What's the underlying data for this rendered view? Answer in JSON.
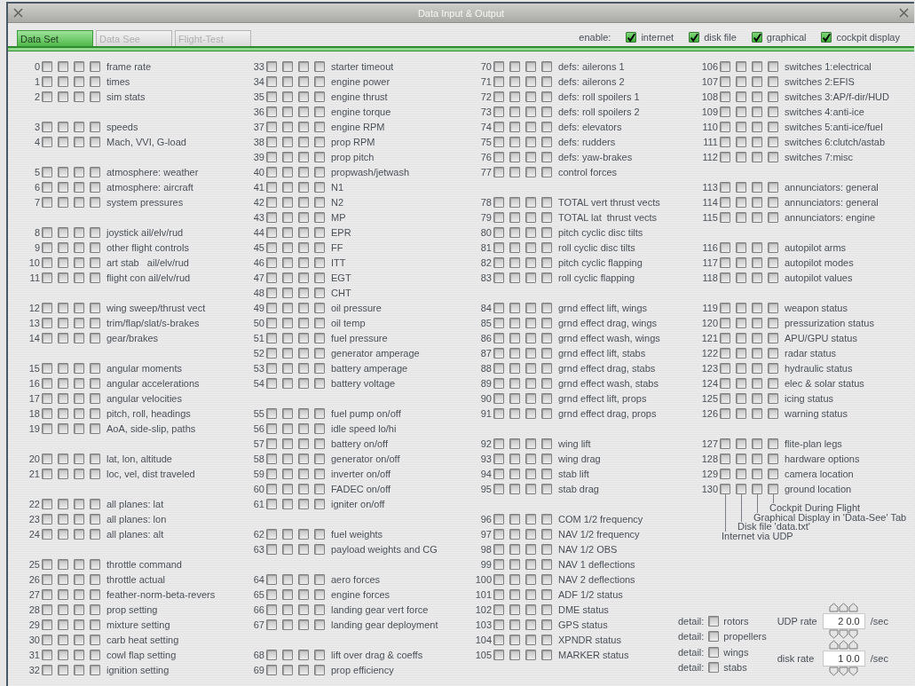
{
  "window": {
    "title": "Data Input & Output"
  },
  "tabs": [
    {
      "label": "Data Set",
      "selected": true
    },
    {
      "label": "Data See",
      "selected": false
    },
    {
      "label": "Flight-Test",
      "selected": false
    }
  ],
  "enable": {
    "label": "enable:",
    "options": [
      {
        "label": "internet",
        "checked": true
      },
      {
        "label": "disk file",
        "checked": true
      },
      {
        "label": "graphical",
        "checked": true
      },
      {
        "label": "cockpit display",
        "checked": true
      }
    ]
  },
  "columns": [
    {
      "groups": [
        {
          "rows": [
            {
              "index": "0",
              "label": "frame rate",
              "checked": [
                false,
                false,
                false,
                false
              ]
            },
            {
              "index": "1",
              "label": "times",
              "checked": [
                false,
                false,
                false,
                false
              ]
            },
            {
              "index": "2",
              "label": "sim stats",
              "checked": [
                false,
                false,
                false,
                false
              ]
            }
          ]
        },
        {
          "rows": [
            {
              "index": "3",
              "label": "speeds",
              "checked": [
                false,
                false,
                false,
                false
              ]
            },
            {
              "index": "4",
              "label": "Mach, VVI, G-load",
              "checked": [
                false,
                false,
                false,
                false
              ]
            }
          ]
        },
        {
          "rows": [
            {
              "index": "5",
              "label": "atmosphere: weather",
              "checked": [
                false,
                false,
                false,
                false
              ]
            },
            {
              "index": "6",
              "label": "atmosphere: aircraft",
              "checked": [
                false,
                false,
                false,
                false
              ]
            },
            {
              "index": "7",
              "label": "system pressures",
              "checked": [
                false,
                false,
                false,
                false
              ]
            }
          ]
        },
        {
          "rows": [
            {
              "index": "8",
              "label": "joystick ail/elv/rud",
              "checked": [
                false,
                false,
                false,
                false
              ]
            },
            {
              "index": "9",
              "label": "other flight controls",
              "checked": [
                false,
                false,
                false,
                false
              ]
            },
            {
              "index": "10",
              "label": "art stab   ail/elv/rud",
              "checked": [
                false,
                false,
                false,
                false
              ]
            },
            {
              "index": "11",
              "label": "flight con ail/elv/rud",
              "checked": [
                false,
                false,
                false,
                false
              ]
            }
          ]
        },
        {
          "rows": [
            {
              "index": "12",
              "label": "wing sweep/thrust vect",
              "checked": [
                false,
                false,
                false,
                false
              ]
            },
            {
              "index": "13",
              "label": "trim/flap/slat/s-brakes",
              "checked": [
                false,
                false,
                false,
                false
              ]
            },
            {
              "index": "14",
              "label": "gear/brakes",
              "checked": [
                false,
                false,
                false,
                false
              ]
            }
          ]
        },
        {
          "rows": [
            {
              "index": "15",
              "label": "angular moments",
              "checked": [
                false,
                false,
                false,
                false
              ]
            },
            {
              "index": "16",
              "label": "angular accelerations",
              "checked": [
                false,
                false,
                false,
                false
              ]
            },
            {
              "index": "17",
              "label": "angular velocities",
              "checked": [
                false,
                false,
                false,
                false
              ]
            },
            {
              "index": "18",
              "label": "pitch, roll, headings",
              "checked": [
                false,
                false,
                false,
                false
              ]
            },
            {
              "index": "19",
              "label": "AoA, side-slip, paths",
              "checked": [
                false,
                false,
                false,
                false
              ]
            }
          ]
        },
        {
          "rows": [
            {
              "index": "20",
              "label": "lat, lon, altitude",
              "checked": [
                false,
                false,
                false,
                false
              ]
            },
            {
              "index": "21",
              "label": "loc, vel, dist traveled",
              "checked": [
                false,
                false,
                false,
                false
              ]
            }
          ]
        },
        {
          "rows": [
            {
              "index": "22",
              "label": "all planes: lat",
              "checked": [
                false,
                false,
                false,
                false
              ]
            },
            {
              "index": "23",
              "label": "all planes: lon",
              "checked": [
                false,
                false,
                false,
                false
              ]
            },
            {
              "index": "24",
              "label": "all planes: alt",
              "checked": [
                false,
                false,
                false,
                false
              ]
            }
          ]
        },
        {
          "rows": [
            {
              "index": "25",
              "label": "throttle command",
              "checked": [
                false,
                false,
                false,
                false
              ]
            },
            {
              "index": "26",
              "label": "throttle actual",
              "checked": [
                false,
                false,
                false,
                false
              ]
            },
            {
              "index": "27",
              "label": "feather-norm-beta-revers",
              "checked": [
                false,
                false,
                false,
                false
              ]
            },
            {
              "index": "28",
              "label": "prop setting",
              "checked": [
                false,
                false,
                false,
                false
              ]
            },
            {
              "index": "29",
              "label": "mixture setting",
              "checked": [
                false,
                false,
                false,
                false
              ]
            },
            {
              "index": "30",
              "label": "carb heat setting",
              "checked": [
                false,
                false,
                false,
                false
              ]
            },
            {
              "index": "31",
              "label": "cowl flap setting",
              "checked": [
                false,
                false,
                false,
                false
              ]
            },
            {
              "index": "32",
              "label": "ignition setting",
              "checked": [
                false,
                false,
                false,
                false
              ]
            }
          ]
        }
      ]
    },
    {
      "groups": [
        {
          "rows": [
            {
              "index": "33",
              "label": "starter timeout",
              "checked": [
                false,
                false,
                false,
                false
              ]
            },
            {
              "index": "34",
              "label": "engine power",
              "checked": [
                false,
                false,
                false,
                false
              ]
            },
            {
              "index": "35",
              "label": "engine thrust",
              "checked": [
                false,
                false,
                false,
                false
              ]
            },
            {
              "index": "36",
              "label": "engine torque",
              "checked": [
                false,
                false,
                false,
                false
              ]
            },
            {
              "index": "37",
              "label": "engine RPM",
              "checked": [
                false,
                false,
                false,
                false
              ]
            },
            {
              "index": "38",
              "label": "prop RPM",
              "checked": [
                false,
                false,
                false,
                false
              ]
            },
            {
              "index": "39",
              "label": "prop pitch",
              "checked": [
                false,
                false,
                false,
                false
              ]
            },
            {
              "index": "40",
              "label": "propwash/jetwash",
              "checked": [
                false,
                false,
                false,
                false
              ]
            },
            {
              "index": "41",
              "label": "N1",
              "checked": [
                false,
                false,
                false,
                false
              ]
            },
            {
              "index": "42",
              "label": "N2",
              "checked": [
                false,
                false,
                false,
                false
              ]
            },
            {
              "index": "43",
              "label": "MP",
              "checked": [
                false,
                false,
                false,
                false
              ]
            },
            {
              "index": "44",
              "label": "EPR",
              "checked": [
                false,
                false,
                false,
                false
              ]
            },
            {
              "index": "45",
              "label": "FF",
              "checked": [
                false,
                false,
                false,
                false
              ]
            },
            {
              "index": "46",
              "label": "ITT",
              "checked": [
                false,
                false,
                false,
                false
              ]
            },
            {
              "index": "47",
              "label": "EGT",
              "checked": [
                false,
                false,
                false,
                false
              ]
            },
            {
              "index": "48",
              "label": "CHT",
              "checked": [
                false,
                false,
                false,
                false
              ]
            },
            {
              "index": "49",
              "label": "oil pressure",
              "checked": [
                false,
                false,
                false,
                false
              ]
            },
            {
              "index": "50",
              "label": "oil temp",
              "checked": [
                false,
                false,
                false,
                false
              ]
            },
            {
              "index": "51",
              "label": "fuel pressure",
              "checked": [
                false,
                false,
                false,
                false
              ]
            },
            {
              "index": "52",
              "label": "generator amperage",
              "checked": [
                false,
                false,
                false,
                false
              ]
            },
            {
              "index": "53",
              "label": "battery amperage",
              "checked": [
                false,
                false,
                false,
                false
              ]
            },
            {
              "index": "54",
              "label": "battery voltage",
              "checked": [
                false,
                false,
                false,
                false
              ]
            }
          ]
        },
        {
          "rows": [
            {
              "index": "55",
              "label": "fuel pump on/off",
              "checked": [
                false,
                false,
                false,
                false
              ]
            },
            {
              "index": "56",
              "label": "idle speed lo/hi",
              "checked": [
                false,
                false,
                false,
                false
              ]
            },
            {
              "index": "57",
              "label": "battery on/off",
              "checked": [
                false,
                false,
                false,
                false
              ]
            },
            {
              "index": "58",
              "label": "generator on/off",
              "checked": [
                false,
                false,
                false,
                false
              ]
            },
            {
              "index": "59",
              "label": "inverter on/off",
              "checked": [
                false,
                false,
                false,
                false
              ]
            },
            {
              "index": "60",
              "label": "FADEC on/off",
              "checked": [
                false,
                false,
                false,
                false
              ]
            },
            {
              "index": "61",
              "label": "igniter on/off",
              "checked": [
                false,
                false,
                false,
                false
              ]
            }
          ]
        },
        {
          "rows": [
            {
              "index": "62",
              "label": "fuel weights",
              "checked": [
                false,
                false,
                false,
                false
              ]
            },
            {
              "index": "63",
              "label": "payload weights and CG",
              "checked": [
                false,
                false,
                false,
                false
              ]
            }
          ]
        },
        {
          "rows": [
            {
              "index": "64",
              "label": "aero forces",
              "checked": [
                false,
                false,
                false,
                false
              ]
            },
            {
              "index": "65",
              "label": "engine forces",
              "checked": [
                false,
                false,
                false,
                false
              ]
            },
            {
              "index": "66",
              "label": "landing gear vert force",
              "checked": [
                false,
                false,
                false,
                false
              ]
            },
            {
              "index": "67",
              "label": "landing gear deployment",
              "checked": [
                false,
                false,
                false,
                false
              ]
            }
          ]
        },
        {
          "rows": [
            {
              "index": "68",
              "label": "lift over drag & coeffs",
              "checked": [
                false,
                false,
                false,
                false
              ]
            },
            {
              "index": "69",
              "label": "prop efficiency",
              "checked": [
                false,
                false,
                false,
                false
              ]
            }
          ]
        }
      ]
    },
    {
      "groups": [
        {
          "rows": [
            {
              "index": "70",
              "label": "defs: ailerons 1",
              "checked": [
                false,
                false,
                false,
                false
              ]
            },
            {
              "index": "71",
              "label": "defs: ailerons 2",
              "checked": [
                false,
                false,
                false,
                false
              ]
            },
            {
              "index": "72",
              "label": "defs: roll spoilers 1",
              "checked": [
                false,
                false,
                false,
                false
              ]
            },
            {
              "index": "73",
              "label": "defs: roll spoilers 2",
              "checked": [
                false,
                false,
                false,
                false
              ]
            },
            {
              "index": "74",
              "label": "defs: elevators",
              "checked": [
                false,
                false,
                false,
                false
              ]
            },
            {
              "index": "75",
              "label": "defs: rudders",
              "checked": [
                false,
                false,
                false,
                false
              ]
            },
            {
              "index": "76",
              "label": "defs: yaw-brakes",
              "checked": [
                false,
                false,
                false,
                false
              ]
            },
            {
              "index": "77",
              "label": "control forces",
              "checked": [
                false,
                false,
                false,
                false
              ]
            }
          ]
        },
        {
          "rows": [
            {
              "index": "78",
              "label": "TOTAL vert thrust vects",
              "checked": [
                false,
                false,
                false,
                false
              ]
            },
            {
              "index": "79",
              "label": "TOTAL lat  thrust vects",
              "checked": [
                false,
                false,
                false,
                false
              ]
            },
            {
              "index": "80",
              "label": "pitch cyclic disc tilts",
              "checked": [
                false,
                false,
                false,
                false
              ]
            },
            {
              "index": "81",
              "label": "roll cyclic disc tilts",
              "checked": [
                false,
                false,
                false,
                false
              ]
            },
            {
              "index": "82",
              "label": "pitch cyclic flapping",
              "checked": [
                false,
                false,
                false,
                false
              ]
            },
            {
              "index": "83",
              "label": "roll cyclic flapping",
              "checked": [
                false,
                false,
                false,
                false
              ]
            }
          ]
        },
        {
          "rows": [
            {
              "index": "84",
              "label": "grnd effect lift, wings",
              "checked": [
                false,
                false,
                false,
                false
              ]
            },
            {
              "index": "85",
              "label": "grnd effect drag, wings",
              "checked": [
                false,
                false,
                false,
                false
              ]
            },
            {
              "index": "86",
              "label": "grnd effect wash, wings",
              "checked": [
                false,
                false,
                false,
                false
              ]
            },
            {
              "index": "87",
              "label": "grnd effect lift, stabs",
              "checked": [
                false,
                false,
                false,
                false
              ]
            },
            {
              "index": "88",
              "label": "grnd effect drag, stabs",
              "checked": [
                false,
                false,
                false,
                false
              ]
            },
            {
              "index": "89",
              "label": "grnd effect wash, stabs",
              "checked": [
                false,
                false,
                false,
                false
              ]
            },
            {
              "index": "90",
              "label": "grnd effect lift, props",
              "checked": [
                false,
                false,
                false,
                false
              ]
            },
            {
              "index": "91",
              "label": "grnd effect drag, props",
              "checked": [
                false,
                false,
                false,
                false
              ]
            }
          ]
        },
        {
          "rows": [
            {
              "index": "92",
              "label": "wing lift",
              "checked": [
                false,
                false,
                false,
                false
              ]
            },
            {
              "index": "93",
              "label": "wing drag",
              "checked": [
                false,
                false,
                false,
                false
              ]
            },
            {
              "index": "94",
              "label": "stab lift",
              "checked": [
                false,
                false,
                false,
                false
              ]
            },
            {
              "index": "95",
              "label": "stab drag",
              "checked": [
                false,
                false,
                false,
                false
              ]
            }
          ]
        },
        {
          "rows": [
            {
              "index": "96",
              "label": "COM 1/2 frequency",
              "checked": [
                false,
                false,
                false,
                false
              ]
            },
            {
              "index": "97",
              "label": "NAV 1/2 frequency",
              "checked": [
                false,
                false,
                false,
                false
              ]
            },
            {
              "index": "98",
              "label": "NAV 1/2 OBS",
              "checked": [
                false,
                false,
                false,
                false
              ]
            },
            {
              "index": "99",
              "label": "NAV 1 deflections",
              "checked": [
                false,
                false,
                false,
                false
              ]
            },
            {
              "index": "100",
              "label": "NAV 2 deflections",
              "checked": [
                false,
                false,
                false,
                false
              ]
            },
            {
              "index": "101",
              "label": "ADF 1/2 status",
              "checked": [
                false,
                false,
                false,
                false
              ]
            },
            {
              "index": "102",
              "label": "DME status",
              "checked": [
                false,
                false,
                false,
                false
              ]
            },
            {
              "index": "103",
              "label": "GPS status",
              "checked": [
                false,
                false,
                false,
                false
              ]
            },
            {
              "index": "104",
              "label": "XPNDR status",
              "checked": [
                false,
                false,
                false,
                false
              ]
            },
            {
              "index": "105",
              "label": "MARKER status",
              "checked": [
                false,
                false,
                false,
                false
              ]
            }
          ]
        }
      ]
    },
    {
      "groups": [
        {
          "rows": [
            {
              "index": "106",
              "label": "switches 1:electrical",
              "checked": [
                false,
                false,
                false,
                false
              ]
            },
            {
              "index": "107",
              "label": "switches 2:EFIS",
              "checked": [
                false,
                false,
                false,
                false
              ]
            },
            {
              "index": "108",
              "label": "switches 3:AP/f-dir/HUD",
              "checked": [
                false,
                false,
                false,
                false
              ]
            },
            {
              "index": "109",
              "label": "switches 4:anti-ice",
              "checked": [
                false,
                false,
                false,
                false
              ]
            },
            {
              "index": "110",
              "label": "switches 5:anti-ice/fuel",
              "checked": [
                false,
                false,
                false,
                false
              ]
            },
            {
              "index": "111",
              "label": "switches 6:clutch/astab",
              "checked": [
                false,
                false,
                false,
                false
              ]
            },
            {
              "index": "112",
              "label": "switches 7:misc",
              "checked": [
                false,
                false,
                false,
                false
              ]
            }
          ]
        },
        {
          "rows": [
            {
              "index": "113",
              "label": "annunciators: general",
              "checked": [
                false,
                false,
                false,
                false
              ]
            },
            {
              "index": "114",
              "label": "annunciators: general",
              "checked": [
                false,
                false,
                false,
                false
              ]
            },
            {
              "index": "115",
              "label": "annunciators: engine",
              "checked": [
                false,
                false,
                false,
                false
              ]
            }
          ]
        },
        {
          "rows": [
            {
              "index": "116",
              "label": "autopilot arms",
              "checked": [
                false,
                false,
                false,
                false
              ]
            },
            {
              "index": "117",
              "label": "autopilot modes",
              "checked": [
                false,
                false,
                false,
                false
              ]
            },
            {
              "index": "118",
              "label": "autopilot values",
              "checked": [
                false,
                false,
                false,
                false
              ]
            }
          ]
        },
        {
          "rows": [
            {
              "index": "119",
              "label": "weapon status",
              "checked": [
                false,
                false,
                false,
                false
              ]
            },
            {
              "index": "120",
              "label": "pressurization status",
              "checked": [
                false,
                false,
                false,
                false
              ]
            },
            {
              "index": "121",
              "label": "APU/GPU status",
              "checked": [
                false,
                false,
                false,
                false
              ]
            },
            {
              "index": "122",
              "label": "radar status",
              "checked": [
                false,
                false,
                false,
                false
              ]
            },
            {
              "index": "123",
              "label": "hydraulic status",
              "checked": [
                false,
                false,
                false,
                false
              ]
            },
            {
              "index": "124",
              "label": "elec & solar status",
              "checked": [
                false,
                false,
                false,
                false
              ]
            },
            {
              "index": "125",
              "label": "icing status",
              "checked": [
                false,
                false,
                false,
                false
              ]
            },
            {
              "index": "126",
              "label": "warning status",
              "checked": [
                false,
                false,
                false,
                false
              ]
            }
          ]
        },
        {
          "rows": [
            {
              "index": "127",
              "label": "flite-plan legs",
              "checked": [
                false,
                false,
                false,
                false
              ]
            },
            {
              "index": "128",
              "label": "hardware options",
              "checked": [
                false,
                false,
                false,
                false
              ]
            },
            {
              "index": "129",
              "label": "camera location",
              "checked": [
                false,
                false,
                false,
                false
              ]
            },
            {
              "index": "130",
              "label": "ground location",
              "checked": [
                false,
                false,
                false,
                false
              ]
            }
          ]
        }
      ]
    }
  ],
  "legend": [
    "Cockpit During Flight",
    "Graphical Display in 'Data-See' Tab",
    "Disk file 'data.txt'",
    "Internet via UDP"
  ],
  "details": [
    {
      "label": "detail:",
      "option": "rotors",
      "checked": false
    },
    {
      "label": "detail:",
      "option": "propellers",
      "checked": false
    },
    {
      "label": "detail:",
      "option": "wings",
      "checked": false
    },
    {
      "label": "detail:",
      "option": "stabs",
      "checked": false
    }
  ],
  "rates": [
    {
      "label": "UDP rate",
      "value": "2 0.0",
      "unit": "/sec"
    },
    {
      "label": "disk rate",
      "value": "1 0.0",
      "unit": "/sec"
    }
  ]
}
